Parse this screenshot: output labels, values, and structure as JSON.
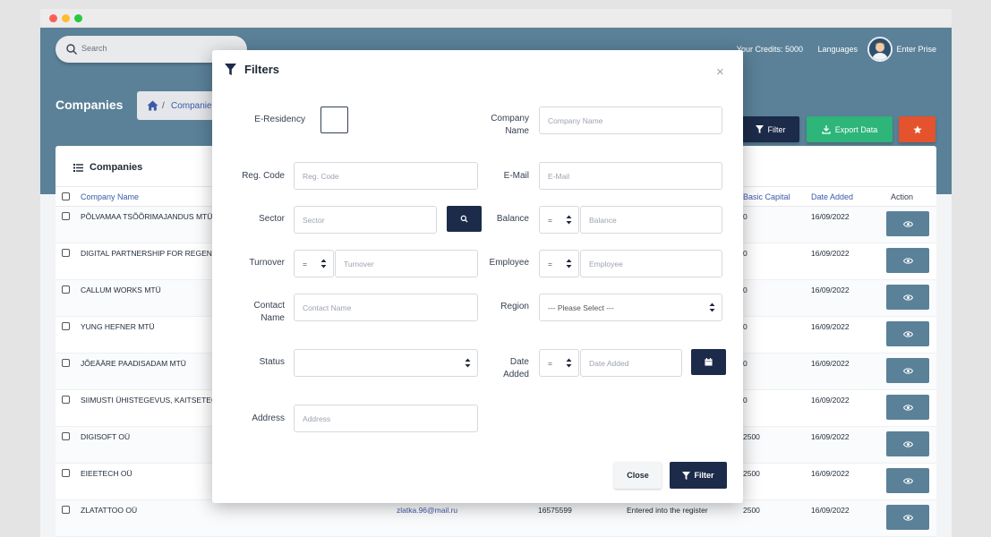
{
  "header": {
    "search_placeholder": "Search",
    "credits": "Your Credits: 5000",
    "languages": "Languages",
    "user_name": "Enter Prise"
  },
  "page": {
    "title": "Companies",
    "breadcrumb": "Companies",
    "breadcrumb_separator": "/"
  },
  "toolbar": {
    "filter_label": "Filter",
    "export_label": "Export Data"
  },
  "card": {
    "title": "Companies"
  },
  "table": {
    "columns": {
      "company_name": "Company Name",
      "basic_capital": "Basic Capital",
      "date_added": "Date Added",
      "action": "Action"
    },
    "rows": [
      {
        "name": "PÕLVAMAA TSÕÕRIMAJANDUS MTÜ",
        "email": "",
        "reg": "",
        "status": "",
        "capital": "0",
        "date": "16/09/2022"
      },
      {
        "name": "DIGITAL PARTNERSHIP FOR REGENERA",
        "email": "",
        "reg": "",
        "status": "",
        "capital": "0",
        "date": "16/09/2022"
      },
      {
        "name": "CALLUM WORKS MTÜ",
        "email": "",
        "reg": "",
        "status": "",
        "capital": "0",
        "date": "16/09/2022"
      },
      {
        "name": "YUNG HEFNER MTÜ",
        "email": "",
        "reg": "",
        "status": "",
        "capital": "0",
        "date": "16/09/2022"
      },
      {
        "name": "JÕEÄÄRE PAADISADAM MTÜ",
        "email": "",
        "reg": "",
        "status": "",
        "capital": "0",
        "date": "16/09/2022"
      },
      {
        "name": "SIIMUSTI ÜHISTEGEVUS, KAITSETEGEV",
        "email": "",
        "reg": "",
        "status": "",
        "capital": "0",
        "date": "16/09/2022"
      },
      {
        "name": "DIGISOFT OÜ",
        "email": "",
        "reg": "",
        "status": "",
        "capital": "2500",
        "date": "16/09/2022"
      },
      {
        "name": "EIEETECH OÜ",
        "email": "",
        "reg": "",
        "status": "",
        "capital": "2500",
        "date": "16/09/2022"
      },
      {
        "name": "ZLATATTOO OÜ",
        "email": "zlatka.96@mail.ru",
        "reg": "16575599",
        "status": "Entered into the register",
        "capital": "2500",
        "date": "16/09/2022"
      }
    ]
  },
  "modal": {
    "title": "Filters",
    "close_symbol": "×",
    "labels": {
      "e_residency": "E-Residency",
      "company_name": "Company Name",
      "reg_code": "Reg. Code",
      "email": "E-Mail",
      "sector": "Sector",
      "balance": "Balance",
      "turnover": "Turnover",
      "employee": "Employee",
      "contact_name": "Contact Name",
      "region": "Region",
      "status": "Status",
      "date_added": "Date Added",
      "address": "Address"
    },
    "placeholders": {
      "company_name": "Company Name",
      "reg_code": "Reg. Code",
      "email": "E-Mail",
      "sector": "Sector",
      "balance": "Balance",
      "turnover": "Turnover",
      "employee": "Employee",
      "contact_name": "Contact Name",
      "date_added": "Date Added",
      "address": "Address"
    },
    "operators": {
      "balance": "=",
      "turnover": "=",
      "employee": "=",
      "date_added": "="
    },
    "region_value": "--- Please Select ---",
    "status_value": "",
    "close_label": "Close",
    "filter_label": "Filter"
  }
}
